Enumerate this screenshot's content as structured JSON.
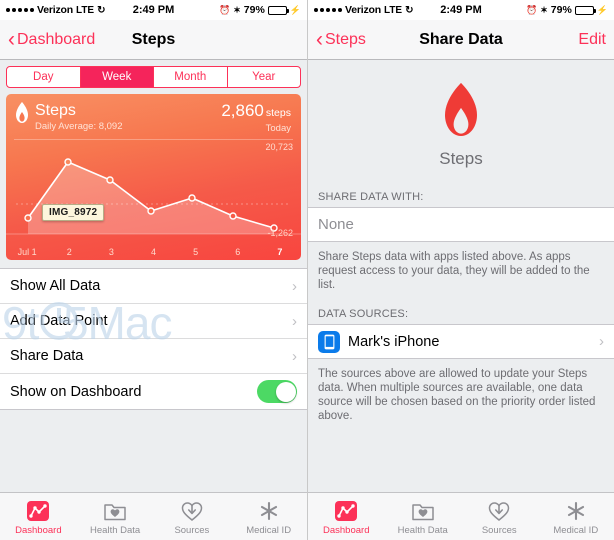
{
  "status_bar": {
    "signal_dots": 5,
    "carrier": "Verizon",
    "network": "LTE",
    "sync_icon": "sync-icon",
    "time": "2:49 PM",
    "alarm_icon": "alarm-icon",
    "bluetooth_icon": "bluetooth-icon",
    "battery_percent": "79%",
    "battery_level": 79,
    "charging_icon": "lightning-bolt-icon"
  },
  "left_screen": {
    "nav": {
      "back_label": "Dashboard",
      "back_icon": "chevron-left-icon",
      "title": "Steps"
    },
    "segmented_control": {
      "options": [
        "Day",
        "Week",
        "Month",
        "Year"
      ],
      "selected": "Week",
      "selected_index": 1,
      "accent_color": "#fc3158",
      "selected_fill": "#f5245b"
    },
    "card": {
      "icon": "flame-icon",
      "title": "Steps",
      "subtitle": "Daily Average: 8,092",
      "value": "2,860",
      "value_unit": "steps",
      "value_caption": "Today",
      "axis_max": "20,723",
      "axis_min": "-1,262",
      "tooltip": "IMG_8972",
      "gradient_start": "#f89063",
      "gradient_end": "#f8453f"
    },
    "rows": [
      {
        "label": "Show All Data",
        "accessory": "chevron-right-icon"
      },
      {
        "label": "Add Data Point",
        "accessory": "chevron-right-icon"
      },
      {
        "label": "Share Data",
        "accessory": "chevron-right-icon"
      },
      {
        "label": "Show on Dashboard",
        "accessory": "toggle-switch",
        "toggle_on": true
      }
    ]
  },
  "right_screen": {
    "nav": {
      "back_label": "Steps",
      "back_icon": "chevron-left-icon",
      "title": "Share Data",
      "edit_label": "Edit"
    },
    "hero": {
      "icon": "flame-icon",
      "label": "Steps"
    },
    "share_section": {
      "header": "SHARE DATA WITH:",
      "value": "None",
      "footnote": "Share Steps data with apps listed above. As apps request access to your data, they will be added to the list."
    },
    "sources_section": {
      "header": "DATA SOURCES:",
      "items": [
        {
          "label": "Mark's iPhone",
          "icon": "iphone-icon",
          "accessory": "chevron-right-icon"
        }
      ],
      "footnote": "The sources above are allowed to update your Steps data. When multiple sources are available, one data source will be chosen based on the priority order listed above."
    }
  },
  "tab_bar": {
    "items": [
      {
        "label": "Dashboard",
        "icon": "dashboard-chart-icon",
        "active": true
      },
      {
        "label": "Health Data",
        "icon": "folder-heart-icon",
        "active": false
      },
      {
        "label": "Sources",
        "icon": "heart-download-icon",
        "active": false
      },
      {
        "label": "Medical ID",
        "icon": "medical-asterisk-icon",
        "active": false
      }
    ],
    "active_color": "#fc3158",
    "inactive_color": "#8e8e93"
  },
  "watermark": {
    "text_before": "9t",
    "text_after": "5Mac",
    "full": "9to5Mac"
  },
  "chart_data": {
    "type": "line",
    "title": "Steps",
    "subtitle": "Daily Average: 8,092",
    "categories": [
      "Jul 1",
      "2",
      "3",
      "4",
      "5",
      "6",
      "7"
    ],
    "values": [
      5200,
      20723,
      16200,
      8700,
      11400,
      6800,
      3900
    ],
    "ylim": [
      -1262,
      20723
    ],
    "ylabel": "steps",
    "xlabel": "",
    "annotations": [
      "IMG_8972"
    ],
    "grid": true,
    "legend": "none",
    "highlight_index": 6,
    "line_color": "#ffffff",
    "fill_color": "rgba(255,255,255,0.28)"
  }
}
